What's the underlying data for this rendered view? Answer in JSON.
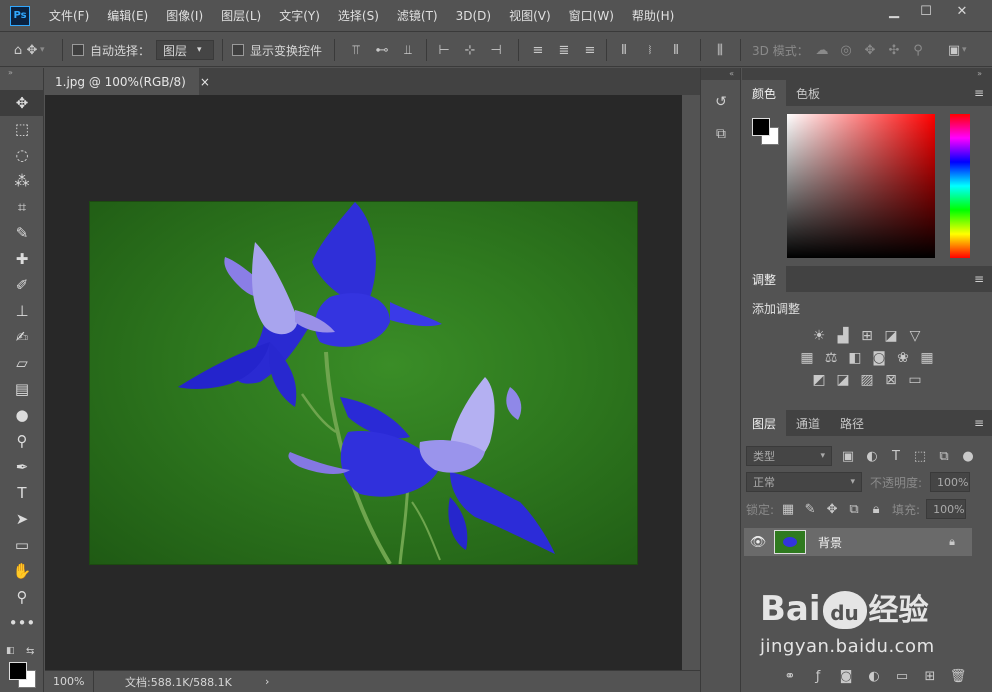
{
  "app": {
    "logo": "Ps",
    "menu": [
      "文件(F)",
      "编辑(E)",
      "图像(I)",
      "图层(L)",
      "文字(Y)",
      "选择(S)",
      "滤镜(T)",
      "3D(D)",
      "视图(V)",
      "窗口(W)",
      "帮助(H)"
    ]
  },
  "options": {
    "auto_select_label": "自动选择：",
    "auto_select_value": "图层",
    "show_transform_label": "显示变换控件",
    "mode_3d_label": "3D 模式："
  },
  "document": {
    "tab_title": "1.jpg @ 100%(RGB/8)",
    "tab_close": "×",
    "zoom": "100%",
    "doc_info": "文档:588.1K/588.1K",
    "status_arrow": "›"
  },
  "color_panel": {
    "tabs": [
      "颜色",
      "色板"
    ]
  },
  "adjust_panel": {
    "tab": "调整",
    "add_label": "添加调整"
  },
  "layers_panel": {
    "tabs": [
      "图层",
      "通道",
      "路径"
    ],
    "filter_kind": "类型",
    "blend_mode": "正常",
    "opacity_label": "不透明度:",
    "opacity_value": "100%",
    "lock_label": "锁定:",
    "fill_label": "填充:",
    "fill_value": "100%",
    "layers": [
      {
        "name": "背景"
      }
    ]
  },
  "watermark": {
    "brand": "Bai",
    "brand_paw": "du",
    "suffix": "经验",
    "url": "jingyan.baidu.com"
  },
  "colors": {
    "accent": "#31a8ff",
    "panel": "#535353",
    "canvas": "#282828"
  }
}
